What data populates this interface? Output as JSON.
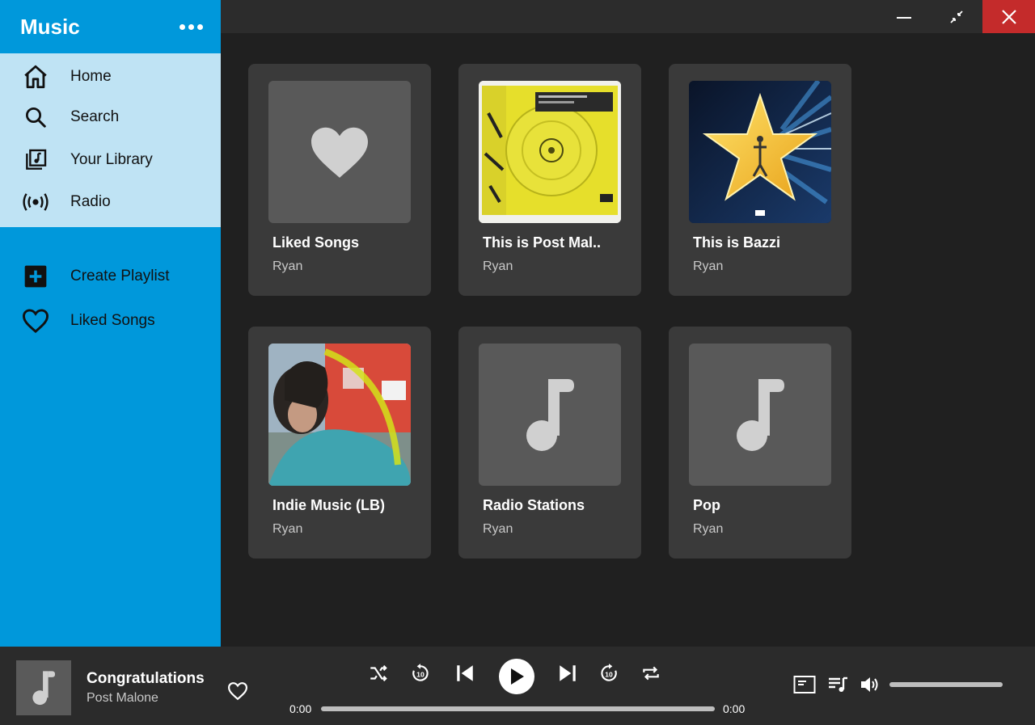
{
  "app": {
    "title": "Music"
  },
  "nav": {
    "items": [
      {
        "label": "Home",
        "icon": "home-icon"
      },
      {
        "label": "Search",
        "icon": "search-icon"
      },
      {
        "label": "Your Library",
        "icon": "library-icon"
      },
      {
        "label": "Radio",
        "icon": "radio-icon"
      }
    ],
    "actions": [
      {
        "label": "Create Playlist",
        "icon": "plus-box-icon"
      },
      {
        "label": "Liked Songs",
        "icon": "heart-outline-icon"
      }
    ]
  },
  "cards": [
    {
      "title": "Liked Songs",
      "subtitle": "Ryan",
      "art": "heart-icon"
    },
    {
      "title": "This is Post Mal..",
      "subtitle": "Ryan",
      "art": "album-cover-yellow"
    },
    {
      "title": "This is Bazzi",
      "subtitle": "Ryan",
      "art": "album-cover-star"
    },
    {
      "title": "Indie Music (LB)",
      "subtitle": "Ryan",
      "art": "album-cover-photo"
    },
    {
      "title": "Radio Stations",
      "subtitle": "Ryan",
      "art": "music-note-icon"
    },
    {
      "title": "Pop",
      "subtitle": "Ryan",
      "art": "music-note-icon"
    }
  ],
  "player": {
    "track_title": "Congratulations",
    "artist": "Post Malone",
    "time_elapsed": "0:00",
    "time_total": "0:00",
    "progress": 0
  },
  "colors": {
    "sidebar": "#0098db",
    "nav_highlight": "#bfe3f4",
    "close_button": "#c42b2b",
    "card": "#3a3a3a"
  }
}
